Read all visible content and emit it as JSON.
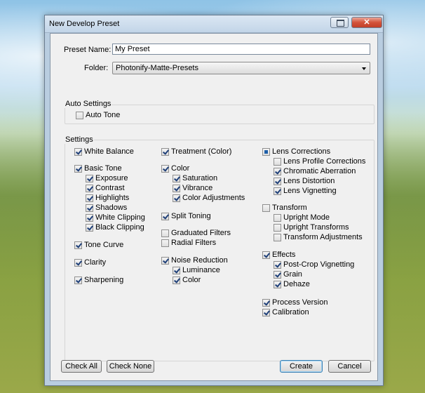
{
  "dialog": {
    "title": "New Develop Preset",
    "close_glyph": "✕"
  },
  "preset_name": {
    "label": "Preset Name:",
    "value": "My Preset"
  },
  "folder": {
    "label": "Folder:",
    "value": "Photonify-Matte-Presets"
  },
  "auto_settings": {
    "title": "Auto Settings",
    "auto_tone": {
      "label": "Auto Tone",
      "checked": false
    }
  },
  "settings": {
    "title": "Settings",
    "col1": [
      {
        "label": "White Balance",
        "state": "checked",
        "indent": 0
      },
      {
        "label": "Basic Tone",
        "state": "checked",
        "indent": 0
      },
      {
        "label": "Exposure",
        "state": "checked",
        "indent": 1
      },
      {
        "label": "Contrast",
        "state": "checked",
        "indent": 1
      },
      {
        "label": "Highlights",
        "state": "checked",
        "indent": 1
      },
      {
        "label": "Shadows",
        "state": "checked",
        "indent": 1
      },
      {
        "label": "White Clipping",
        "state": "checked",
        "indent": 1
      },
      {
        "label": "Black Clipping",
        "state": "checked",
        "indent": 1
      },
      {
        "label": "Tone Curve",
        "state": "checked",
        "indent": 0
      },
      {
        "label": "Clarity",
        "state": "checked",
        "indent": 0
      },
      {
        "label": "Sharpening",
        "state": "checked",
        "indent": 0
      }
    ],
    "col2": [
      {
        "label": "Treatment (Color)",
        "state": "checked",
        "indent": 0
      },
      {
        "label": "Color",
        "state": "checked",
        "indent": 0
      },
      {
        "label": "Saturation",
        "state": "checked",
        "indent": 1
      },
      {
        "label": "Vibrance",
        "state": "checked",
        "indent": 1
      },
      {
        "label": "Color Adjustments",
        "state": "checked",
        "indent": 1
      },
      {
        "label": "Split Toning",
        "state": "checked",
        "indent": 0
      },
      {
        "label": "Graduated Filters",
        "state": "unchecked",
        "indent": 0
      },
      {
        "label": "Radial Filters",
        "state": "unchecked",
        "indent": 0
      },
      {
        "label": "Noise Reduction",
        "state": "checked",
        "indent": 0
      },
      {
        "label": "Luminance",
        "state": "checked",
        "indent": 1
      },
      {
        "label": "Color",
        "state": "checked",
        "indent": 1
      }
    ],
    "col3": [
      {
        "label": "Lens Corrections",
        "state": "partial",
        "indent": 0
      },
      {
        "label": "Lens Profile Corrections",
        "state": "unchecked",
        "indent": 1
      },
      {
        "label": "Chromatic Aberration",
        "state": "checked",
        "indent": 1
      },
      {
        "label": "Lens Distortion",
        "state": "checked",
        "indent": 1
      },
      {
        "label": "Lens Vignetting",
        "state": "checked",
        "indent": 1
      },
      {
        "label": "Transform",
        "state": "unchecked",
        "indent": 0
      },
      {
        "label": "Upright Mode",
        "state": "unchecked",
        "indent": 1
      },
      {
        "label": "Upright Transforms",
        "state": "unchecked",
        "indent": 1
      },
      {
        "label": "Transform Adjustments",
        "state": "unchecked",
        "indent": 1
      },
      {
        "label": "Effects",
        "state": "checked",
        "indent": 0
      },
      {
        "label": "Post-Crop Vignetting",
        "state": "checked",
        "indent": 1
      },
      {
        "label": "Grain",
        "state": "checked",
        "indent": 1
      },
      {
        "label": "Dehaze",
        "state": "checked",
        "indent": 1
      },
      {
        "label": "Process Version",
        "state": "checked",
        "indent": 0
      },
      {
        "label": "Calibration",
        "state": "checked",
        "indent": 0
      }
    ]
  },
  "buttons": {
    "check_all": "Check All",
    "check_none": "Check None",
    "create": "Create",
    "cancel": "Cancel"
  }
}
